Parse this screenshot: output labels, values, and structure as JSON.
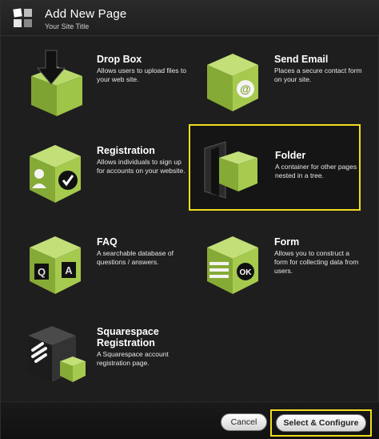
{
  "header": {
    "title": "Add New Page",
    "subtitle": "Your Site Title"
  },
  "items": [
    {
      "name": "Drop Box",
      "description": "Allows users to upload files to your web site.",
      "icon": "dropbox-icon"
    },
    {
      "name": "Send Email",
      "description": "Places a secure contact form on your site.",
      "icon": "email-icon"
    },
    {
      "name": "Registration",
      "description": "Allows individuals to sign up for accounts on your website.",
      "icon": "registration-icon"
    },
    {
      "name": "Folder",
      "description": "A container for other pages nested in a tree.",
      "icon": "folder-icon",
      "selected": true
    },
    {
      "name": "FAQ",
      "description": "A searchable database of questions / answers.",
      "icon": "faq-icon"
    },
    {
      "name": "Form",
      "description": "Allows you to construct a form for collecting data from users.",
      "icon": "form-icon"
    },
    {
      "name": "Squarespace Registration",
      "description": "A Squarespace account registration page.",
      "icon": "squarespace-icon"
    }
  ],
  "footer": {
    "cancel_label": "Cancel",
    "select_label": "Select & Configure"
  },
  "colors": {
    "background": "#1e1e1e",
    "cube_green": "#8fb63c",
    "highlight": "#f2dc1e"
  }
}
